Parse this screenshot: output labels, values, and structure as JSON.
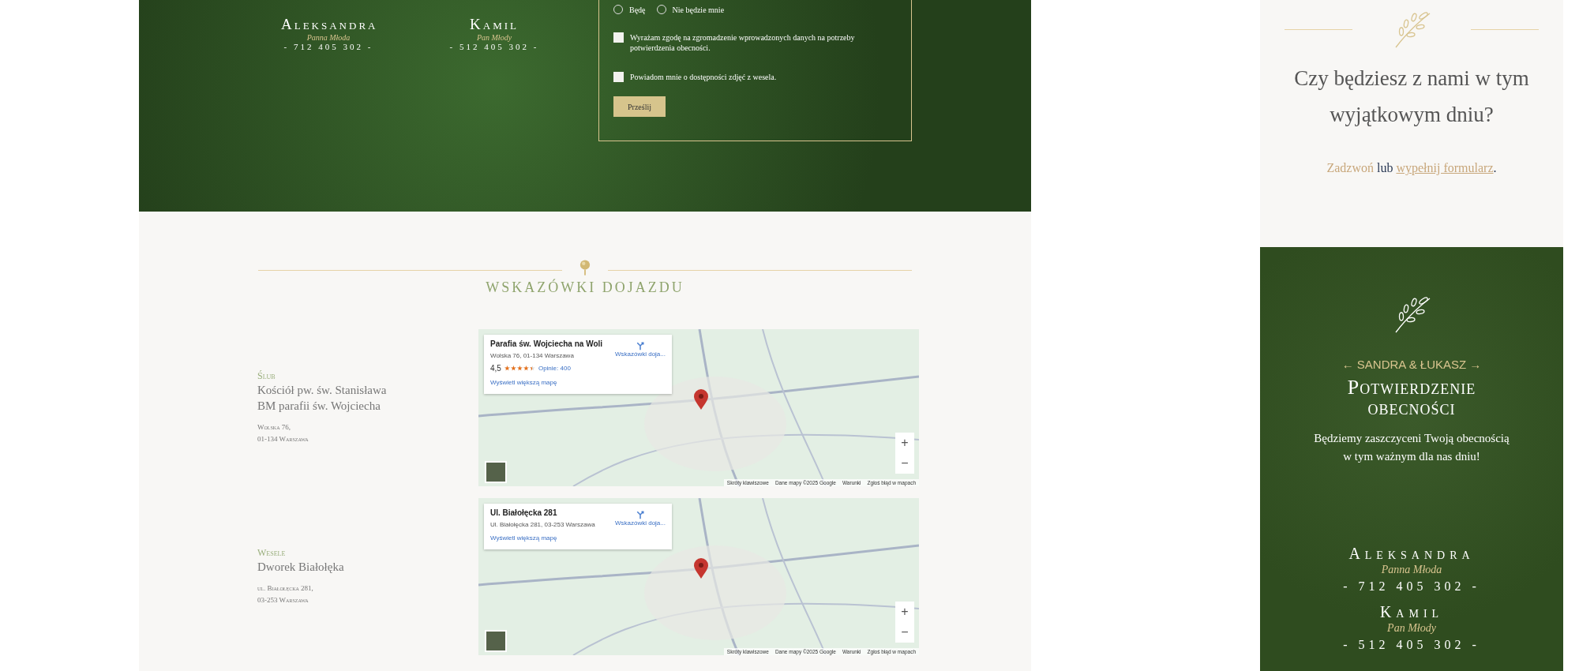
{
  "hero": {
    "couple": [
      {
        "name": "Aleksandra",
        "role": "Panna Młoda",
        "phone": "- 712 405 302 -"
      },
      {
        "name": "Kamil",
        "role": "Pan Młody",
        "phone": "- 512 405 302 -"
      }
    ],
    "form": {
      "radios": [
        {
          "label": "Będę",
          "selected": false
        },
        {
          "label": "Nie będzie mnie",
          "selected": false
        }
      ],
      "checkboxes": [
        {
          "label": "Wyrażam zgodę na zgromadzenie wprowadzonych danych na potrzeby potwierdzenia obecności.",
          "checked": false
        },
        {
          "label": "Powiadom mnie o dostępności zdjęć z wesela.",
          "checked": false
        }
      ],
      "submit": "Prześlij"
    }
  },
  "directions": {
    "title": "WSKAZÓWKI DOJAZDU",
    "venues": [
      {
        "type": "Ślub",
        "name_lines": [
          "Kościół pw. św. Stanisława",
          "BM parafii św. Wojciecha"
        ],
        "address_lines": [
          "Wolska 76,",
          "01-134 Warszawa"
        ],
        "map": {
          "place": "Parafia św. Wojciecha na Woli",
          "address": "Wolska 76, 01-134 Warszawa",
          "rating": "4,5",
          "stars": 4.5,
          "reviews": "Opinie: 400",
          "directions": "Wskazówki doja...",
          "larger_map": "Wyświetl większą mapę",
          "zoom_in": "+",
          "zoom_out": "−",
          "footer": [
            "Skróty klawiszowe",
            "Dane mapy ©2025 Google",
            "Warunki",
            "Zgłoś błąd w mapach"
          ]
        }
      },
      {
        "type": "Wesele",
        "name_lines": [
          "Dworek Białołęka"
        ],
        "address_lines": [
          "ul. Białołęcka 281,",
          "03-253 Warszawa"
        ],
        "map": {
          "place": "Ul. Białołęcka 281",
          "address": "Ul. Białołęcka 281, 03-253 Warszawa",
          "directions": "Wskazówki doja...",
          "larger_map": "Wyświetl większą mapę",
          "zoom_in": "+",
          "zoom_out": "−",
          "footer": [
            "Skróty klawiszowe",
            "Dane mapy ©2025 Google",
            "Warunki",
            "Zgłoś błąd w mapach"
          ]
        }
      }
    ]
  },
  "sidebar": {
    "question": "Czy będziesz z nami w tym wyjątkowym dniu?",
    "contact": {
      "call_link": "Zadzwoń",
      "middle": "lub",
      "form_link": "wypełnij formularz",
      "end": "."
    },
    "rsvp": {
      "couple": "← SANDRA & ŁUKASZ →",
      "title": "Potwierdzenie obecności",
      "text_lines": [
        "Będziemy zaszczyceni Twoją obecnością",
        "w tym ważnym dla nas dniu!"
      ],
      "contacts": [
        {
          "name": "Aleksandra",
          "role": "Panna Młoda",
          "phone": "- 712 405 302 -"
        },
        {
          "name": "Kamil",
          "role": "Pan Młody",
          "phone": "- 512 405 302 -"
        }
      ]
    }
  }
}
